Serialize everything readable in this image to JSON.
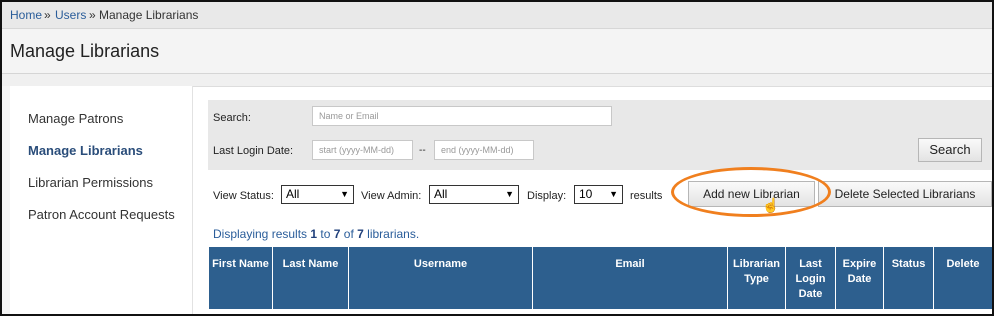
{
  "breadcrumb": {
    "home": "Home",
    "sep1": "»",
    "users": "Users",
    "sep2": "»",
    "current": "Manage Librarians"
  },
  "page_title": "Manage Librarians",
  "sidebar": {
    "items": [
      {
        "label": "Manage Patrons"
      },
      {
        "label": "Manage Librarians"
      },
      {
        "label": "Librarian Permissions"
      },
      {
        "label": "Patron Account Requests"
      }
    ]
  },
  "filters": {
    "search_label": "Search:",
    "search_placeholder": "Name or Email",
    "last_login_label": "Last Login Date:",
    "start_placeholder": "start (yyyy-MM-dd)",
    "dash": "--",
    "end_placeholder": "end (yyyy-MM-dd)",
    "search_button": "Search"
  },
  "controls": {
    "view_status_label": "View Status:",
    "view_status_value": "All",
    "view_admin_label": "View Admin:",
    "view_admin_value": "All",
    "display_label": "Display:",
    "display_value": "10",
    "results_label": "results",
    "add_button": "Add new Librarian",
    "delete_button": "Delete Selected Librarians"
  },
  "summary": {
    "prefix": "Displaying results ",
    "from": "1",
    "to_word": " to ",
    "to": "7",
    "of_word": " of ",
    "total": "7",
    "suffix": " librarians."
  },
  "table": {
    "headers": [
      "First Name",
      "Last Name",
      "Username",
      "Email",
      "Librarian Type",
      "Last Login Date",
      "Expire Date",
      "Status",
      "Delete"
    ]
  },
  "colors": {
    "header_bg": "#2d5f8e",
    "highlight_oval": "#f07f1e",
    "link": "#2a5d9a"
  },
  "icons": {
    "cursor": "hand-pointer-icon"
  }
}
